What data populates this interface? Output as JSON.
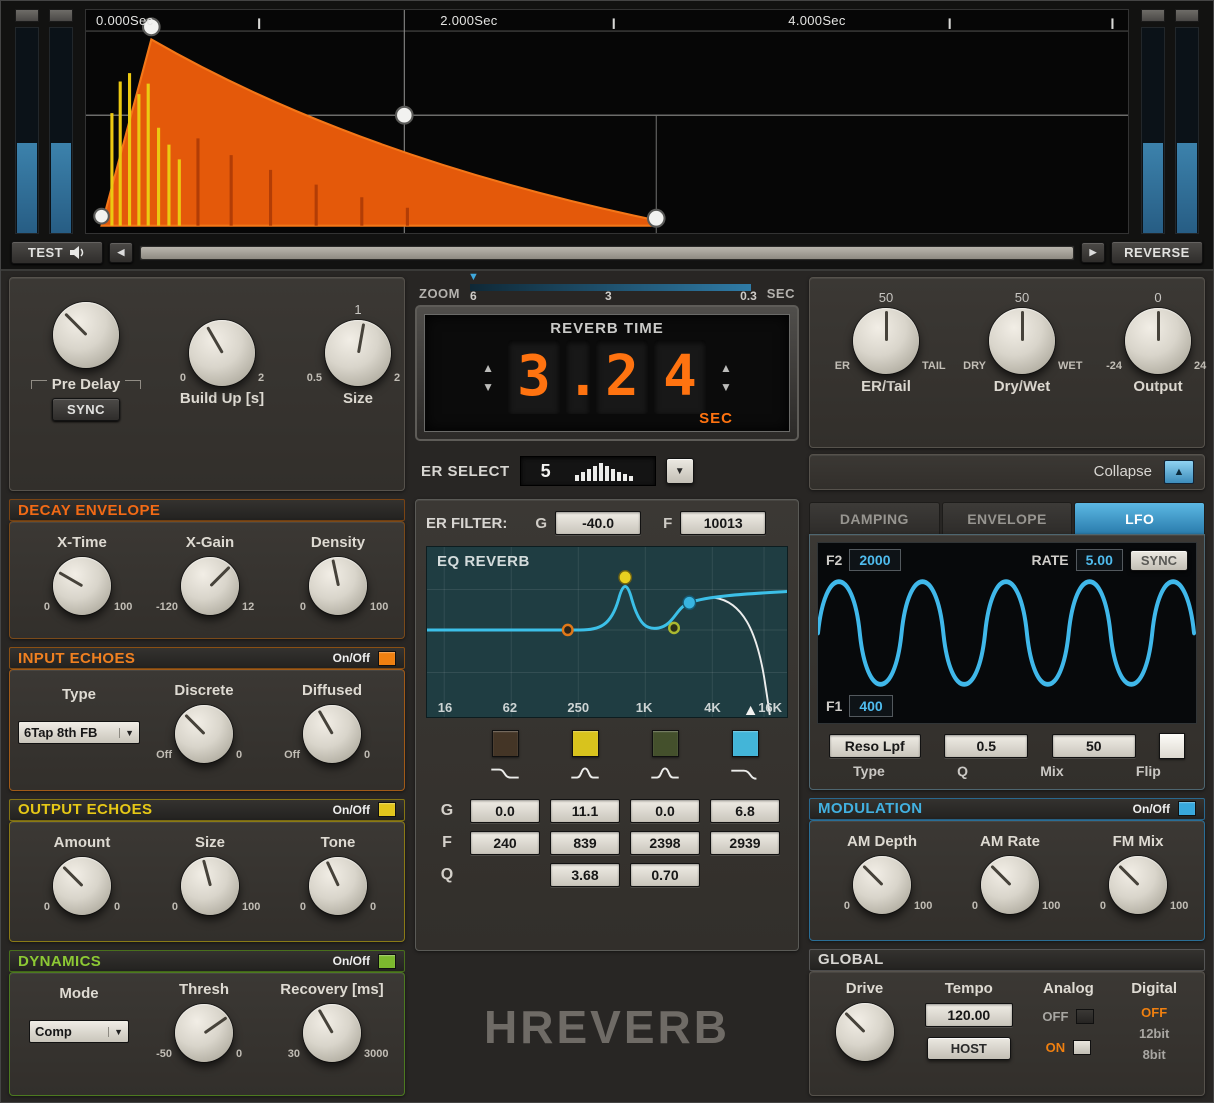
{
  "colors": {
    "orange": "#f08010",
    "yellow": "#e2c51c",
    "green": "#7cb82e",
    "blue": "#38a8dc"
  },
  "icons": {
    "up": "▲",
    "down": "▼",
    "left": "◀",
    "right": "▶"
  },
  "visualizer": {
    "time_labels": [
      "0.000Sec",
      "2.000Sec",
      "4.000Sec"
    ],
    "test_label": "TEST",
    "reverse_label": "REVERSE"
  },
  "zoom": {
    "label": "ZOOM",
    "ticks": [
      "6",
      "3",
      "0.3"
    ],
    "unit": "SEC"
  },
  "predelay": {
    "knob1_label": "Pre Delay",
    "sync_label": "SYNC",
    "knob2": {
      "label": "Build Up [s]",
      "min": "0",
      "max": "2"
    },
    "knob3": {
      "label": "Size",
      "min": "0.5",
      "max": "2",
      "value": "1"
    }
  },
  "reverb_time": {
    "title": "REVERB TIME",
    "digits": [
      "3",
      ".",
      "2",
      "4"
    ],
    "unit": "SEC"
  },
  "er_select": {
    "label": "ER SELECT",
    "value": "5"
  },
  "er_filter": {
    "label": "ER FILTER:",
    "g_label": "G",
    "g_value": "-40.0",
    "f_label": "F",
    "f_value": "10013"
  },
  "eq": {
    "title": "EQ REVERB",
    "freq_labels": [
      "16",
      "62",
      "250",
      "1K",
      "4K",
      "16K"
    ],
    "row_g": "G",
    "row_f": "F",
    "row_q": "Q",
    "bands": [
      {
        "name": "low",
        "color": "#443526",
        "g": "0.0",
        "f": "240"
      },
      {
        "name": "peak1",
        "color": "#d8c31d",
        "g": "11.1",
        "f": "839",
        "q": "3.68"
      },
      {
        "name": "peak2",
        "color": "#44502c",
        "g": "0.0",
        "f": "2398",
        "q": "0.70"
      },
      {
        "name": "high",
        "color": "#43b5d8",
        "g": "6.8",
        "f": "2939"
      }
    ]
  },
  "logo": "HREVERB",
  "master": {
    "knobs": [
      {
        "value": "50",
        "min": "ER",
        "max": "TAIL",
        "label": "ER/Tail"
      },
      {
        "value": "50",
        "min": "DRY",
        "max": "WET",
        "label": "Dry/Wet"
      },
      {
        "value": "0",
        "min": "-24",
        "max": "24",
        "label": "Output"
      }
    ],
    "collapse_label": "Collapse"
  },
  "tabs": {
    "damping": "DAMPING",
    "envelope": "ENVELOPE",
    "lfo": "LFO"
  },
  "lfo": {
    "f2_label": "F2",
    "f2_value": "2000",
    "rate_label": "RATE",
    "rate_value": "5.00",
    "sync_label": "SYNC",
    "f1_label": "F1",
    "f1_value": "400",
    "type_value": "Reso Lpf",
    "q_value": "0.5",
    "mix_value": "50",
    "type_label": "Type",
    "q_label": "Q",
    "mix_label": "Mix",
    "flip_label": "Flip"
  },
  "sections": {
    "decay": {
      "title": "DECAY ENVELOPE"
    },
    "input_echoes": {
      "title": "INPUT ECHOES",
      "onoff": "On/Off"
    },
    "output_echoes": {
      "title": "OUTPUT ECHOES",
      "onoff": "On/Off"
    },
    "dynamics": {
      "title": "DYNAMICS",
      "onoff": "On/Off"
    },
    "modulation": {
      "title": "MODULATION",
      "onoff": "On/Off"
    },
    "global": {
      "title": "GLOBAL"
    }
  },
  "decay": {
    "knobs": [
      {
        "label": "X-Time",
        "min": "0",
        "max": "100"
      },
      {
        "label": "X-Gain",
        "min": "-120",
        "max": "12"
      },
      {
        "label": "Density",
        "min": "0",
        "max": "100"
      }
    ]
  },
  "input_echoes": {
    "type_label": "Type",
    "type_value": "6Tap 8th FB",
    "knobs": [
      {
        "label": "Discrete",
        "min": "Off",
        "max": "0"
      },
      {
        "label": "Diffused",
        "min": "Off",
        "max": "0"
      }
    ]
  },
  "output_echoes": {
    "knobs": [
      {
        "label": "Amount",
        "min": "0",
        "max": "0"
      },
      {
        "label": "Size",
        "min": "0",
        "max": "100"
      },
      {
        "label": "Tone",
        "min": "0",
        "max": "0"
      }
    ]
  },
  "dynamics": {
    "mode_label": "Mode",
    "mode_value": "Comp",
    "knobs": [
      {
        "label": "Thresh",
        "min": "-50",
        "max": "0"
      },
      {
        "label": "Recovery [ms]",
        "min": "30",
        "max": "3000"
      }
    ]
  },
  "modulation": {
    "knobs": [
      {
        "label": "AM Depth",
        "min": "0",
        "max": "100"
      },
      {
        "label": "AM Rate",
        "min": "0",
        "max": "100"
      },
      {
        "label": "FM Mix",
        "min": "0",
        "max": "100"
      }
    ]
  },
  "global": {
    "drive_label": "Drive",
    "tempo_label": "Tempo",
    "tempo_value": "120.00",
    "host_label": "HOST",
    "analog_label": "Analog",
    "analog_off": "OFF",
    "analog_on": "ON",
    "digital_label": "Digital",
    "digital_off": "OFF",
    "digital_12": "12bit",
    "digital_8": "8bit"
  }
}
